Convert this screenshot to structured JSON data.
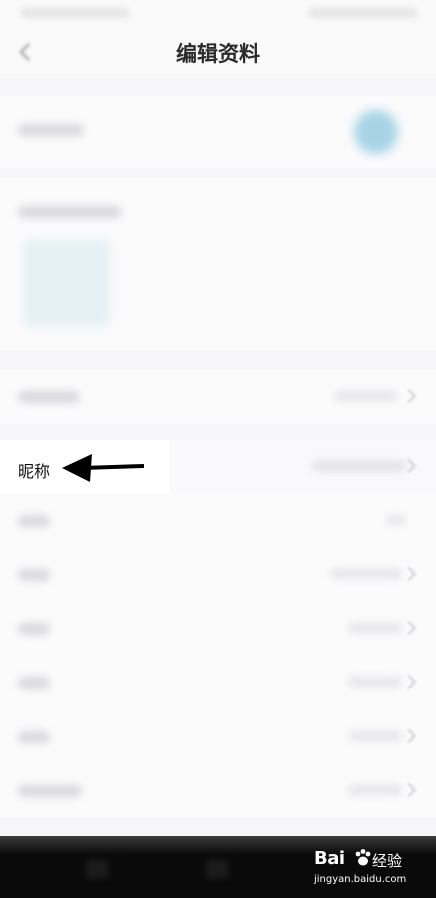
{
  "header": {
    "title": "编辑资料"
  },
  "profile": {
    "nickname_label": "昵称"
  },
  "watermark": {
    "brand": "Bai",
    "brand_suffix": "经验",
    "url": "jingyan.baidu.com"
  },
  "colors": {
    "page_background": "#f6f6f8",
    "row_background": "#fbfbfc",
    "arrow": "#000000"
  },
  "icons": [
    "back-icon",
    "chevron-right-icon",
    "arrow-annotation-icon",
    "baidu-paw-icon"
  ]
}
